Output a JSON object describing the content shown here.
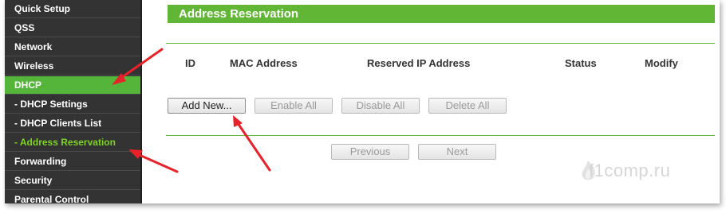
{
  "sidebar": {
    "items": [
      {
        "label": "Quick Setup"
      },
      {
        "label": "QSS"
      },
      {
        "label": "Network"
      },
      {
        "label": "Wireless"
      },
      {
        "label": "DHCP"
      },
      {
        "label": "- DHCP Settings"
      },
      {
        "label": "- DHCP Clients List"
      },
      {
        "label": "- Address Reservation"
      },
      {
        "label": "Forwarding"
      },
      {
        "label": "Security"
      },
      {
        "label": "Parental Control"
      }
    ],
    "active_color": "#55b53a",
    "subactive_color": "#7ed321"
  },
  "main": {
    "title": "Address Reservation",
    "accent_color": "#61b735",
    "table": {
      "columns": [
        "ID",
        "MAC Address",
        "Reserved IP Address",
        "Status",
        "Modify"
      ],
      "rows": []
    },
    "buttons": {
      "add_new": "Add New...",
      "enable_all": "Enable All",
      "disable_all": "Disable All",
      "delete_all": "Delete All",
      "previous": "Previous",
      "next": "Next"
    }
  },
  "watermark": "f1comp.ru",
  "annotations": {
    "arrow_color": "#e8222a"
  }
}
